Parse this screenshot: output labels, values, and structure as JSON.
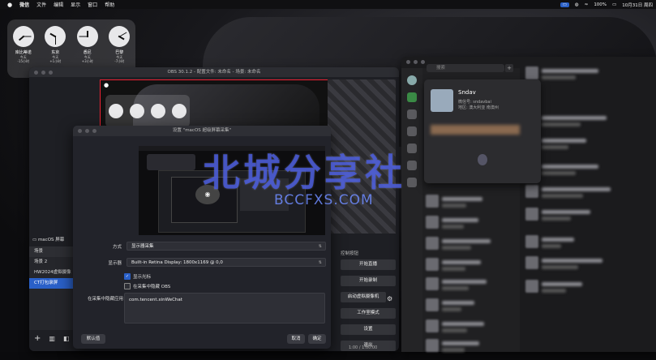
{
  "menubar": {
    "items": [
      "微信",
      "文件",
      "编辑",
      "显示",
      "窗口",
      "帮助"
    ],
    "status": {
      "battery": "100%",
      "date": "10月31日 周四"
    }
  },
  "clocks": [
    {
      "city": "库比蒂诺",
      "day": "今天",
      "offset": "-15小时",
      "h": 230,
      "m": 90
    },
    {
      "city": "东京",
      "day": "今天",
      "offset": "+1小时",
      "h": 300,
      "m": 180
    },
    {
      "city": "悉尼",
      "day": "今天",
      "offset": "+3小时",
      "h": 0,
      "m": 270
    },
    {
      "city": "巴黎",
      "day": "今天",
      "offset": "-7小时",
      "h": 120,
      "m": 60
    }
  ],
  "obs": {
    "title": "OBS 30.1.2 - 配置文件: 未命名 - 场景: 未命名",
    "source_label": "macOS 屏幕",
    "scenes_header": "场景",
    "scenes": [
      "场景 2",
      "HW2024虚拟摄像",
      "CT打包录屏"
    ],
    "selected_scene_index": 2,
    "controls_header": "控制按钮",
    "controls": [
      "开始直播",
      "开始录制",
      "启动虚拟摄像机",
      "工作室模式",
      "设置",
      "退出"
    ],
    "status_time": "1:00 / 1:00:00"
  },
  "dialog": {
    "title": "设置 \"macOS 超级屏幕采集\"",
    "method_label": "方式",
    "method_value": "显示器采集",
    "display_label": "显示器",
    "display_value": "Built-in Retina Display: 1800x1169 @ 0,0",
    "show_cursor": "显示光标",
    "hide_obs": "在采集中隐藏 OBS",
    "hide_apps_label": "在采集中隐藏应用",
    "hide_apps_value": "com.tencent.xinWeChat",
    "defaults_button": "默认值",
    "cancel_button": "取消",
    "ok_button": "确定",
    "show_cursor_checked": true,
    "hide_obs_checked": false
  },
  "wechat": {
    "search_placeholder": "搜索",
    "profile": {
      "name": "Sndav",
      "wechat_id": "微信号: sndavbai",
      "region": "地区: 澳大利亚 南澳州"
    }
  },
  "watermark": {
    "main": "北城分享社",
    "sub": "BCCFXS.COM"
  },
  "colors": {
    "accent": "#2a60c8",
    "recording_border": "#e23",
    "watermark": "#4a5ae6"
  }
}
